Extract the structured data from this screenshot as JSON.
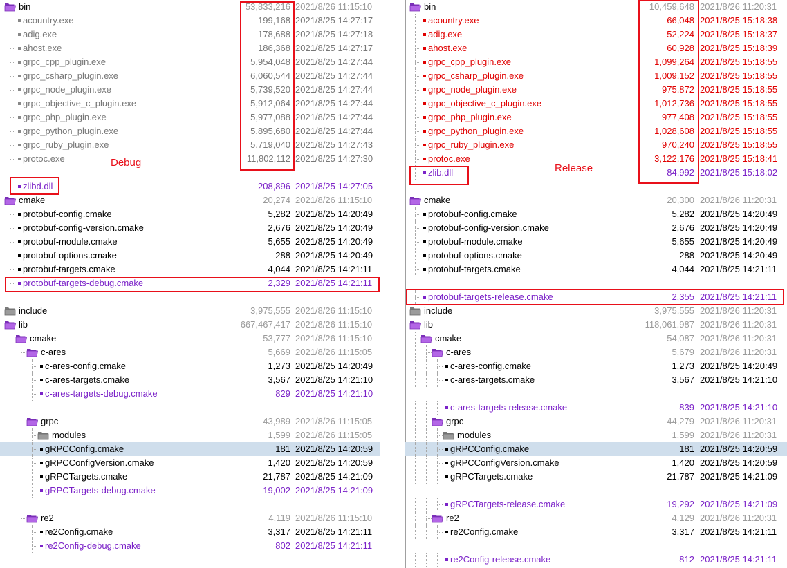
{
  "colors": {
    "same": "#000000",
    "dir_meta": "#9a9a9a",
    "left_diff": "#777777",
    "right_diff": "#e00000",
    "unique": "#7b22c8",
    "selection": "#cfdeec",
    "annotation": "#e8101a"
  },
  "annotations": {
    "left_note": "Debug",
    "right_note": "Release"
  },
  "left": [
    {
      "name": "bin",
      "type": "folder",
      "color": "open",
      "size": "53,833,216",
      "date": "2021/8/26 11:15:10"
    },
    {
      "name": "acountry.exe",
      "type": "file",
      "status": "left",
      "size": "199,168",
      "date": "2021/8/25 14:27:17"
    },
    {
      "name": "adig.exe",
      "type": "file",
      "status": "left",
      "size": "178,688",
      "date": "2021/8/25 14:27:18"
    },
    {
      "name": "ahost.exe",
      "type": "file",
      "status": "left",
      "size": "186,368",
      "date": "2021/8/25 14:27:17"
    },
    {
      "name": "grpc_cpp_plugin.exe",
      "type": "file",
      "status": "left",
      "size": "5,954,048",
      "date": "2021/8/25 14:27:44"
    },
    {
      "name": "grpc_csharp_plugin.exe",
      "type": "file",
      "status": "left",
      "size": "6,060,544",
      "date": "2021/8/25 14:27:44"
    },
    {
      "name": "grpc_node_plugin.exe",
      "type": "file",
      "status": "left",
      "size": "5,739,520",
      "date": "2021/8/25 14:27:44"
    },
    {
      "name": "grpc_objective_c_plugin.exe",
      "type": "file",
      "status": "left",
      "size": "5,912,064",
      "date": "2021/8/25 14:27:44"
    },
    {
      "name": "grpc_php_plugin.exe",
      "type": "file",
      "status": "left",
      "size": "5,977,088",
      "date": "2021/8/25 14:27:44"
    },
    {
      "name": "grpc_python_plugin.exe",
      "type": "file",
      "status": "left",
      "size": "5,895,680",
      "date": "2021/8/25 14:27:44"
    },
    {
      "name": "grpc_ruby_plugin.exe",
      "type": "file",
      "status": "left",
      "size": "5,719,040",
      "date": "2021/8/25 14:27:43"
    },
    {
      "name": "protoc.exe",
      "type": "file",
      "status": "left",
      "size": "11,802,112",
      "date": "2021/8/25 14:27:30"
    },
    {
      "name": "zlibd.dll",
      "type": "file",
      "status": "unique",
      "size": "208,896",
      "date": "2021/8/25 14:27:05"
    },
    {
      "name": "cmake",
      "type": "folder",
      "color": "open",
      "size": "20,274",
      "date": "2021/8/26 11:15:10"
    },
    {
      "name": "protobuf-config.cmake",
      "type": "file",
      "status": "same",
      "size": "5,282",
      "date": "2021/8/25 14:20:49"
    },
    {
      "name": "protobuf-config-version.cmake",
      "type": "file",
      "status": "same",
      "size": "2,676",
      "date": "2021/8/25 14:20:49"
    },
    {
      "name": "protobuf-module.cmake",
      "type": "file",
      "status": "same",
      "size": "5,655",
      "date": "2021/8/25 14:20:49"
    },
    {
      "name": "protobuf-options.cmake",
      "type": "file",
      "status": "same",
      "size": "288",
      "date": "2021/8/25 14:20:49"
    },
    {
      "name": "protobuf-targets.cmake",
      "type": "file",
      "status": "same",
      "size": "4,044",
      "date": "2021/8/25 14:21:11"
    },
    {
      "name": "protobuf-targets-debug.cmake",
      "type": "file",
      "status": "unique",
      "size": "2,329",
      "date": "2021/8/25 14:21:11"
    },
    {
      "name": "include",
      "type": "folder",
      "color": "closed",
      "size": "3,975,555",
      "date": "2021/8/26 11:15:10"
    },
    {
      "name": "lib",
      "type": "folder",
      "color": "open",
      "size": "667,467,417",
      "date": "2021/8/26 11:15:10"
    },
    {
      "name": "cmake",
      "type": "folder",
      "color": "open",
      "size": "53,777",
      "date": "2021/8/26 11:15:10"
    },
    {
      "name": "c-ares",
      "type": "folder",
      "color": "open",
      "size": "5,669",
      "date": "2021/8/26 11:15:05"
    },
    {
      "name": "c-ares-config.cmake",
      "type": "file",
      "status": "same",
      "size": "1,273",
      "date": "2021/8/25 14:20:49"
    },
    {
      "name": "c-ares-targets.cmake",
      "type": "file",
      "status": "same",
      "size": "3,567",
      "date": "2021/8/25 14:21:10"
    },
    {
      "name": "c-ares-targets-debug.cmake",
      "type": "file",
      "status": "unique",
      "size": "829",
      "date": "2021/8/25 14:21:10"
    },
    {
      "name": "grpc",
      "type": "folder",
      "color": "open",
      "size": "43,989",
      "date": "2021/8/26 11:15:05"
    },
    {
      "name": "modules",
      "type": "folder",
      "color": "closed",
      "size": "1,599",
      "date": "2021/8/26 11:15:05"
    },
    {
      "name": "gRPCConfig.cmake",
      "type": "file",
      "status": "same",
      "size": "181",
      "date": "2021/8/25 14:20:59"
    },
    {
      "name": "gRPCConfigVersion.cmake",
      "type": "file",
      "status": "same",
      "size": "1,420",
      "date": "2021/8/25 14:20:59"
    },
    {
      "name": "gRPCTargets.cmake",
      "type": "file",
      "status": "same",
      "size": "21,787",
      "date": "2021/8/25 14:21:09"
    },
    {
      "name": "gRPCTargets-debug.cmake",
      "type": "file",
      "status": "unique",
      "size": "19,002",
      "date": "2021/8/25 14:21:09"
    },
    {
      "name": "re2",
      "type": "folder",
      "color": "open",
      "size": "4,119",
      "date": "2021/8/26 11:15:10"
    },
    {
      "name": "re2Config.cmake",
      "type": "file",
      "status": "same",
      "size": "3,317",
      "date": "2021/8/25 14:21:11"
    },
    {
      "name": "re2Config-debug.cmake",
      "type": "file",
      "status": "unique",
      "size": "802",
      "date": "2021/8/25 14:21:11"
    }
  ],
  "right": [
    {
      "name": "bin",
      "type": "folder",
      "color": "open",
      "size": "10,459,648",
      "date": "2021/8/26 11:20:31"
    },
    {
      "name": "acountry.exe",
      "type": "file",
      "status": "right",
      "size": "66,048",
      "date": "2021/8/25 15:18:38"
    },
    {
      "name": "adig.exe",
      "type": "file",
      "status": "right",
      "size": "52,224",
      "date": "2021/8/25 15:18:37"
    },
    {
      "name": "ahost.exe",
      "type": "file",
      "status": "right",
      "size": "60,928",
      "date": "2021/8/25 15:18:39"
    },
    {
      "name": "grpc_cpp_plugin.exe",
      "type": "file",
      "status": "right",
      "size": "1,099,264",
      "date": "2021/8/25 15:18:55"
    },
    {
      "name": "grpc_csharp_plugin.exe",
      "type": "file",
      "status": "right",
      "size": "1,009,152",
      "date": "2021/8/25 15:18:55"
    },
    {
      "name": "grpc_node_plugin.exe",
      "type": "file",
      "status": "right",
      "size": "975,872",
      "date": "2021/8/25 15:18:55"
    },
    {
      "name": "grpc_objective_c_plugin.exe",
      "type": "file",
      "status": "right",
      "size": "1,012,736",
      "date": "2021/8/25 15:18:55"
    },
    {
      "name": "grpc_php_plugin.exe",
      "type": "file",
      "status": "right",
      "size": "977,408",
      "date": "2021/8/25 15:18:55"
    },
    {
      "name": "grpc_python_plugin.exe",
      "type": "file",
      "status": "right",
      "size": "1,028,608",
      "date": "2021/8/25 15:18:55"
    },
    {
      "name": "grpc_ruby_plugin.exe",
      "type": "file",
      "status": "right",
      "size": "970,240",
      "date": "2021/8/25 15:18:55"
    },
    {
      "name": "protoc.exe",
      "type": "file",
      "status": "right",
      "size": "3,122,176",
      "date": "2021/8/25 15:18:41"
    },
    {
      "name": "zlib.dll",
      "type": "file",
      "status": "unique",
      "size": "84,992",
      "date": "2021/8/25 15:18:02"
    },
    {
      "name": "cmake",
      "type": "folder",
      "color": "open",
      "size": "20,300",
      "date": "2021/8/26 11:20:31"
    },
    {
      "name": "protobuf-config.cmake",
      "type": "file",
      "status": "same",
      "size": "5,282",
      "date": "2021/8/25 14:20:49"
    },
    {
      "name": "protobuf-config-version.cmake",
      "type": "file",
      "status": "same",
      "size": "2,676",
      "date": "2021/8/25 14:20:49"
    },
    {
      "name": "protobuf-module.cmake",
      "type": "file",
      "status": "same",
      "size": "5,655",
      "date": "2021/8/25 14:20:49"
    },
    {
      "name": "protobuf-options.cmake",
      "type": "file",
      "status": "same",
      "size": "288",
      "date": "2021/8/25 14:20:49"
    },
    {
      "name": "protobuf-targets.cmake",
      "type": "file",
      "status": "same",
      "size": "4,044",
      "date": "2021/8/25 14:21:11"
    },
    {
      "name": "protobuf-targets-release.cmake",
      "type": "file",
      "status": "unique",
      "size": "2,355",
      "date": "2021/8/25 14:21:11"
    },
    {
      "name": "include",
      "type": "folder",
      "color": "closed",
      "size": "3,975,555",
      "date": "2021/8/26 11:20:31"
    },
    {
      "name": "lib",
      "type": "folder",
      "color": "open",
      "size": "118,061,987",
      "date": "2021/8/26 11:20:31"
    },
    {
      "name": "cmake",
      "type": "folder",
      "color": "open",
      "size": "54,087",
      "date": "2021/8/26 11:20:31"
    },
    {
      "name": "c-ares",
      "type": "folder",
      "color": "open",
      "size": "5,679",
      "date": "2021/8/26 11:20:31"
    },
    {
      "name": "c-ares-config.cmake",
      "type": "file",
      "status": "same",
      "size": "1,273",
      "date": "2021/8/25 14:20:49"
    },
    {
      "name": "c-ares-targets.cmake",
      "type": "file",
      "status": "same",
      "size": "3,567",
      "date": "2021/8/25 14:21:10"
    },
    {
      "name": "c-ares-targets-release.cmake",
      "type": "file",
      "status": "unique",
      "size": "839",
      "date": "2021/8/25 14:21:10"
    },
    {
      "name": "grpc",
      "type": "folder",
      "color": "open",
      "size": "44,279",
      "date": "2021/8/26 11:20:31"
    },
    {
      "name": "modules",
      "type": "folder",
      "color": "closed",
      "size": "1,599",
      "date": "2021/8/26 11:20:31"
    },
    {
      "name": "gRPCConfig.cmake",
      "type": "file",
      "status": "same",
      "size": "181",
      "date": "2021/8/25 14:20:59"
    },
    {
      "name": "gRPCConfigVersion.cmake",
      "type": "file",
      "status": "same",
      "size": "1,420",
      "date": "2021/8/25 14:20:59"
    },
    {
      "name": "gRPCTargets.cmake",
      "type": "file",
      "status": "same",
      "size": "21,787",
      "date": "2021/8/25 14:21:09"
    },
    {
      "name": "gRPCTargets-release.cmake",
      "type": "file",
      "status": "unique",
      "size": "19,292",
      "date": "2021/8/25 14:21:09"
    },
    {
      "name": "re2",
      "type": "folder",
      "color": "open",
      "size": "4,129",
      "date": "2021/8/26 11:20:31"
    },
    {
      "name": "re2Config.cmake",
      "type": "file",
      "status": "same",
      "size": "3,317",
      "date": "2021/8/25 14:21:11"
    },
    {
      "name": "re2Config-release.cmake",
      "type": "file",
      "status": "unique",
      "size": "812",
      "date": "2021/8/25 14:21:11"
    }
  ]
}
